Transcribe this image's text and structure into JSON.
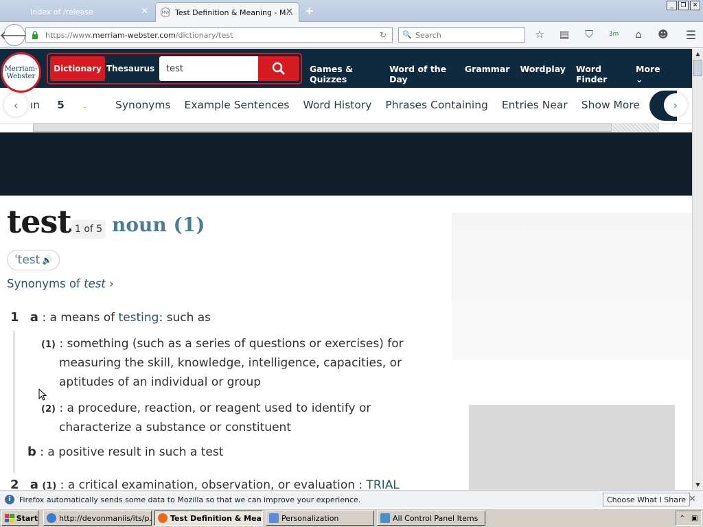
{
  "browser": {
    "tabs": [
      {
        "title": "Index of /release"
      },
      {
        "title": "Test Definition & Meaning - M...",
        "favicon": "MW"
      }
    ],
    "new_tab": "+",
    "window_controls": [
      "_",
      "❐",
      "✕"
    ],
    "url_prefix": "https://www.",
    "url_domain": "merriam-webster.com",
    "url_path": "/dictionary/test",
    "search_placeholder": "Search",
    "downloads_badge": "3m"
  },
  "site": {
    "logo_line1": "Merriam-",
    "logo_line2": "Webster",
    "search_tabs": {
      "dictionary": "Dictionary",
      "thesaurus": "Thesaurus"
    },
    "search_value": "test",
    "nav": [
      "Games & Quizzes",
      "Word of the Day",
      "Grammar",
      "Wordplay",
      "Word Finder",
      "More"
    ],
    "subnav": {
      "partial": "ın",
      "count": "5",
      "items": [
        "Synonyms",
        "Example Sentences",
        "Word History",
        "Phrases Containing",
        "Entries Near",
        "Show More"
      ]
    }
  },
  "entry": {
    "headword": "test",
    "entry_count": "1 of 5",
    "pos": "noun (1)",
    "pronunciation": "ˈtest",
    "synonyms_link_prefix": "Synonyms of ",
    "synonyms_link_word": "test",
    "defs": {
      "d1_num": "1",
      "d1a_letter": "a",
      "d1a_pre": ": a means of ",
      "d1a_link": "testing",
      "d1a_post": ": such as",
      "d1a1_num": "(1)",
      "d1a1_line1": ": something (such as a series of questions or exercises) for",
      "d1a1_line2": "measuring the skill, knowledge, intelligence, capacities, or",
      "d1a1_line3": "aptitudes of an individual or group",
      "d1a2_num": "(2)",
      "d1a2_line1": ": a procedure, reaction, or reagent used to identify or",
      "d1a2_line2": "characterize a substance or constituent",
      "d1b_letter": "b",
      "d1b_text": ": a positive result in such a test",
      "d2_num": "2",
      "d2a_letter": "a",
      "d2a1_num": "(1)",
      "d2a1_text": ": a critical examination, observation, or evaluation ",
      "d2a1_sep": ": ",
      "d2a1_link": "TRIAL"
    }
  },
  "notification": {
    "text": "Firefox automatically sends some data to Mozilla so that we can improve your experience.",
    "button": "Choose What I Share"
  },
  "taskbar": {
    "start": "Start",
    "tasks": [
      {
        "label": "http://devonmaniis/its/p..."
      },
      {
        "label": "Test Definition & Mea..."
      },
      {
        "label": "Personalization"
      },
      {
        "label": "All Control Panel Items"
      }
    ]
  },
  "colors": {
    "brand_red": "#d71920",
    "brand_navy": "#0f2a3f",
    "link_teal": "#265667"
  }
}
